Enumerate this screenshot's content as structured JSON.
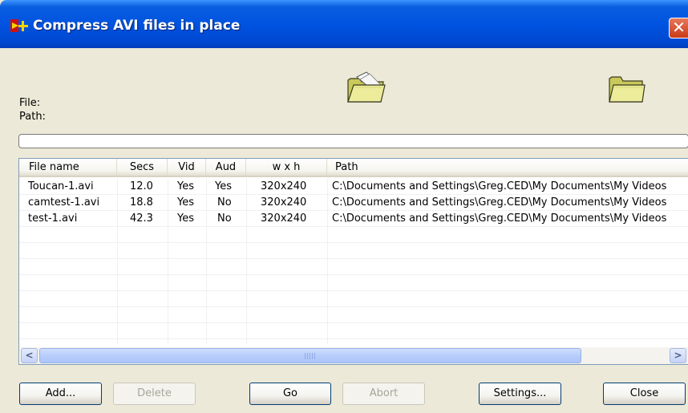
{
  "window": {
    "title": "Compress AVI files in place",
    "close_glyph": "✕"
  },
  "labels": {
    "file": "File:",
    "path": "Path:"
  },
  "icons": {
    "open_file": "open-folder-icon",
    "select_folder": "folder-icon"
  },
  "list": {
    "columns": [
      "File name",
      "Secs",
      "Vid",
      "Aud",
      "w x h",
      "Path"
    ],
    "rows": [
      {
        "name": "Toucan-1.avi",
        "secs": "12.0",
        "vid": "Yes",
        "aud": "Yes",
        "wxh": "320x240",
        "path": "C:\\Documents and Settings\\Greg.CED\\My Documents\\My Videos"
      },
      {
        "name": "camtest-1.avi",
        "secs": "18.8",
        "vid": "Yes",
        "aud": "No",
        "wxh": "320x240",
        "path": "C:\\Documents and Settings\\Greg.CED\\My Documents\\My Videos"
      },
      {
        "name": "test-1.avi",
        "secs": "42.3",
        "vid": "Yes",
        "aud": "No",
        "wxh": "320x240",
        "path": "C:\\Documents and Settings\\Greg.CED\\My Documents\\My Videos"
      }
    ]
  },
  "scrollbar": {
    "left": "<",
    "right": ">"
  },
  "buttons": {
    "add": "Add...",
    "delete": "Delete",
    "go": "Go",
    "abort": "Abort",
    "settings": "Settings...",
    "close": "Close"
  },
  "colors": {
    "title_bar": "#0053e0",
    "face": "#ece9d8",
    "close_button": "#c93a18"
  }
}
